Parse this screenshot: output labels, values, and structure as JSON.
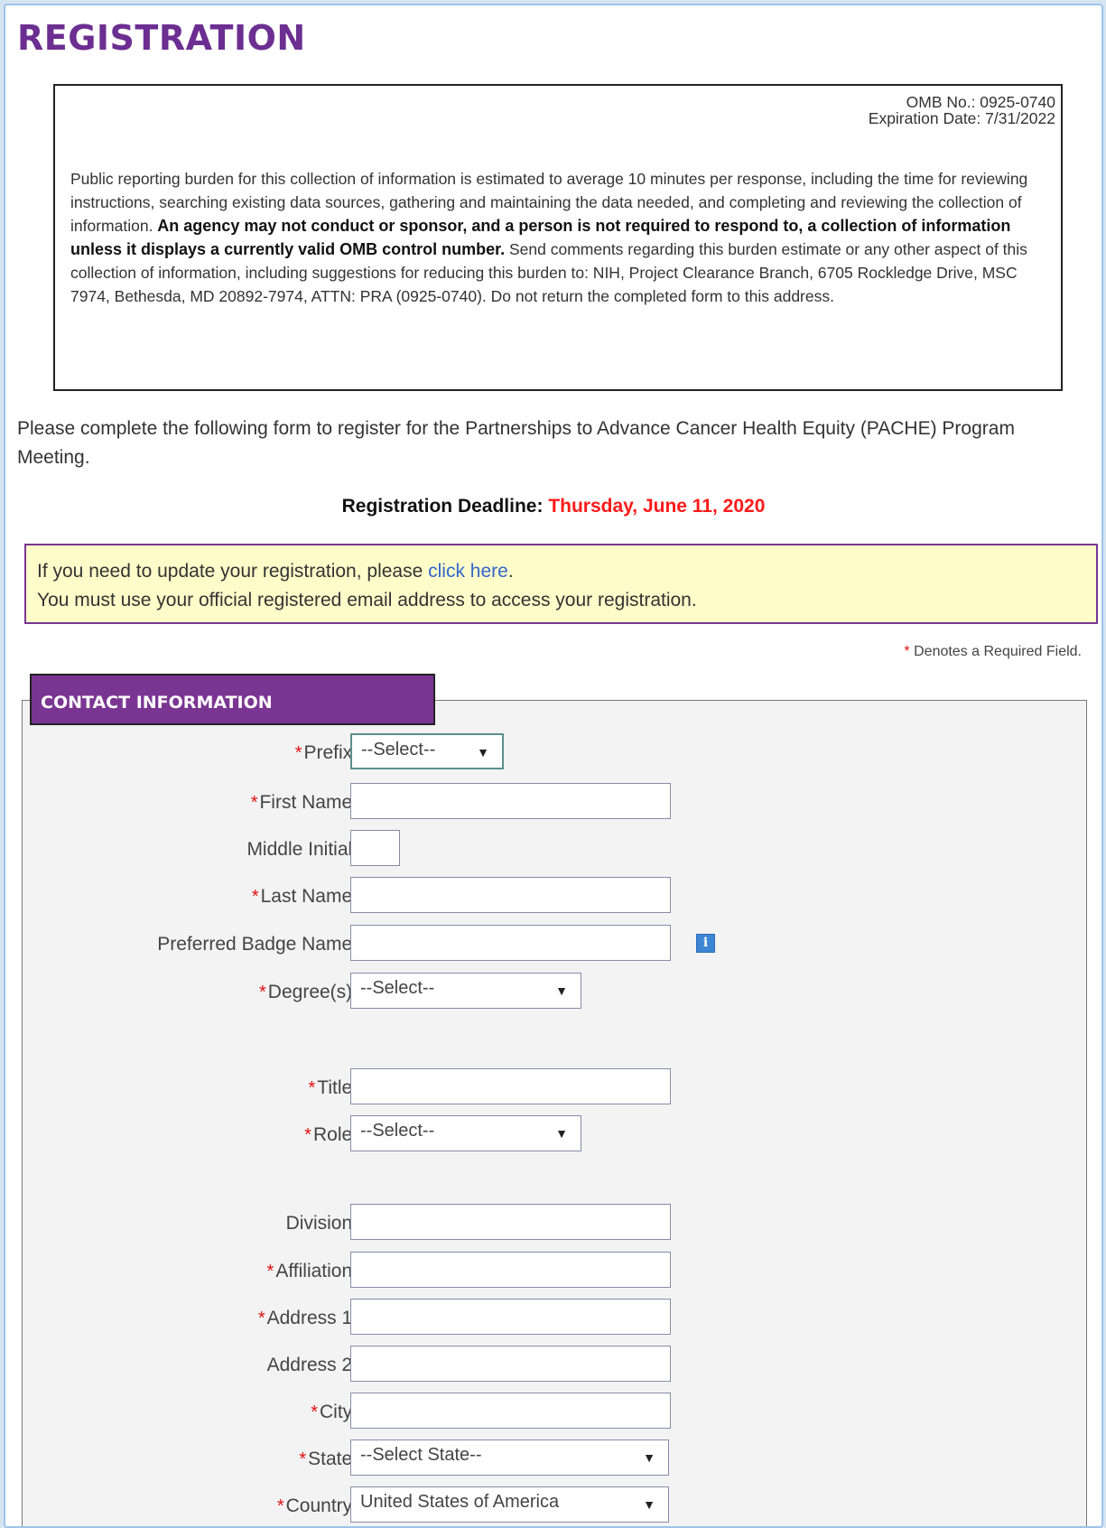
{
  "page_title": "REGISTRATION",
  "omb": {
    "number": "OMB No.: 0925-0740",
    "expiration": "Expiration Date: 7/31/2022",
    "burden_part1": "Public reporting burden for this collection of information is estimated to average 10 minutes per response, including the time for reviewing instructions, searching existing data sources, gathering and maintaining the data needed, and completing and reviewing the collection of information. ",
    "burden_bold": "An agency may not conduct or sponsor, and a person is not required to respond to, a collection of information unless it displays a currently valid OMB control number.",
    "burden_part2": " Send comments regarding this burden estimate or any other aspect of this collection of information, including suggestions for reducing this burden to: NIH, Project Clearance Branch, 6705 Rockledge Drive, MSC 7974, Bethesda, MD 20892-7974, ATTN: PRA (0925-0740). Do not return the completed form to this address."
  },
  "intro": "Please complete the following form to register for the Partnerships to Advance Cancer Health Equity (PACHE) Program Meeting.",
  "deadline": {
    "label": "Registration Deadline:",
    "date": "Thursday, June 11, 2020"
  },
  "notice": {
    "line1_prefix": "If you need to update your registration, please ",
    "link": "click here",
    "line1_suffix": ".",
    "line2": "You must use your official registered email address to access your registration."
  },
  "required_note": {
    "star": "*",
    "text": "Denotes a Required Field."
  },
  "section_title": "CONTACT INFORMATION",
  "fields": {
    "prefix": {
      "label": "Prefix:",
      "value": "--Select--"
    },
    "first_name": {
      "label": "First Name:",
      "value": ""
    },
    "middle_initial": {
      "label": "Middle Initial:",
      "value": ""
    },
    "last_name": {
      "label": "Last Name:",
      "value": ""
    },
    "badge_name": {
      "label": "Preferred Badge Name:",
      "value": "",
      "info_icon": "i"
    },
    "degrees": {
      "label": "Degree(s):",
      "value": "--Select--"
    },
    "title": {
      "label": "Title:",
      "value": ""
    },
    "role": {
      "label": "Role:",
      "value": "--Select--"
    },
    "division": {
      "label": "Division:",
      "value": ""
    },
    "affiliation": {
      "label": "Affiliation:",
      "value": ""
    },
    "address1": {
      "label": "Address 1:",
      "value": ""
    },
    "address2": {
      "label": "Address 2:",
      "value": ""
    },
    "city": {
      "label": "City:",
      "value": ""
    },
    "state": {
      "label": "State:",
      "value": "--Select State--"
    },
    "country": {
      "label": "Country:",
      "value": "United States of America"
    }
  },
  "star": "*",
  "arrow": "▼"
}
